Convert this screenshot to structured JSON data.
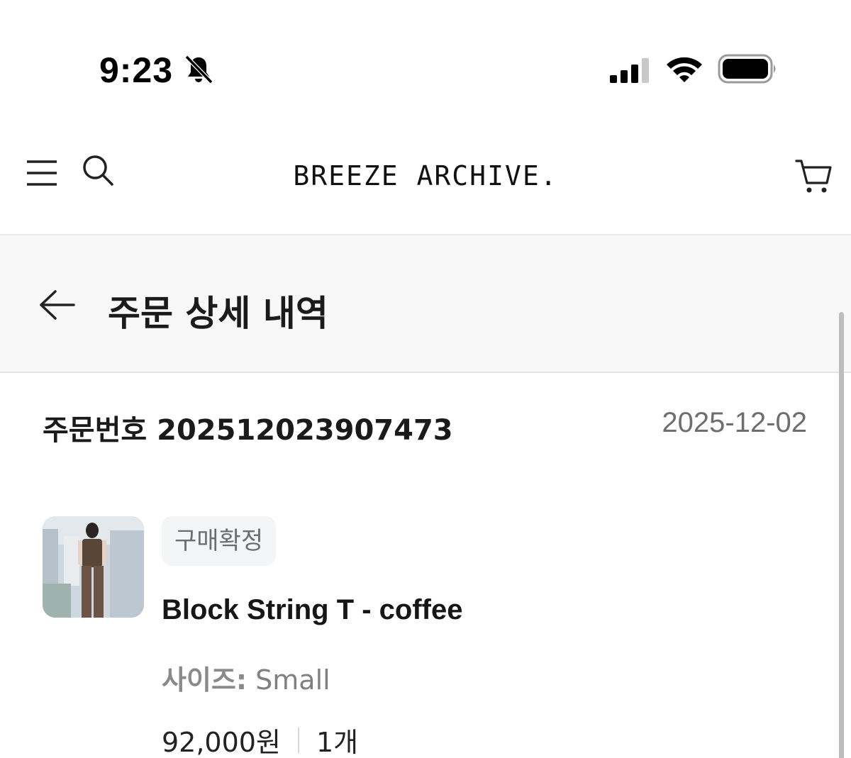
{
  "status_bar": {
    "time": "9:23",
    "icons": [
      "bell-slash-icon",
      "cellular-signal-icon",
      "wifi-icon",
      "battery-icon"
    ]
  },
  "header": {
    "brand": "BREEZE ARCHIVE.",
    "icons": [
      "menu-icon",
      "search-icon",
      "cart-icon"
    ]
  },
  "title_bar": {
    "title": "주문 상세 내역",
    "back_icon": "arrow-left-icon"
  },
  "order": {
    "number_label": "주문번호 202512023907473",
    "date": "2025-12-02",
    "item": {
      "status": "구매확정",
      "name": "Block String T - coffee",
      "option_label": "사이즈:",
      "option_value": " Small",
      "price": "92,000원",
      "quantity": "1개"
    }
  },
  "colors": {
    "background": "#ffffff",
    "title_bar_bg": "#f8f8f9",
    "badge_bg": "#f4f5f6",
    "muted_text": "#6e6e6e"
  }
}
